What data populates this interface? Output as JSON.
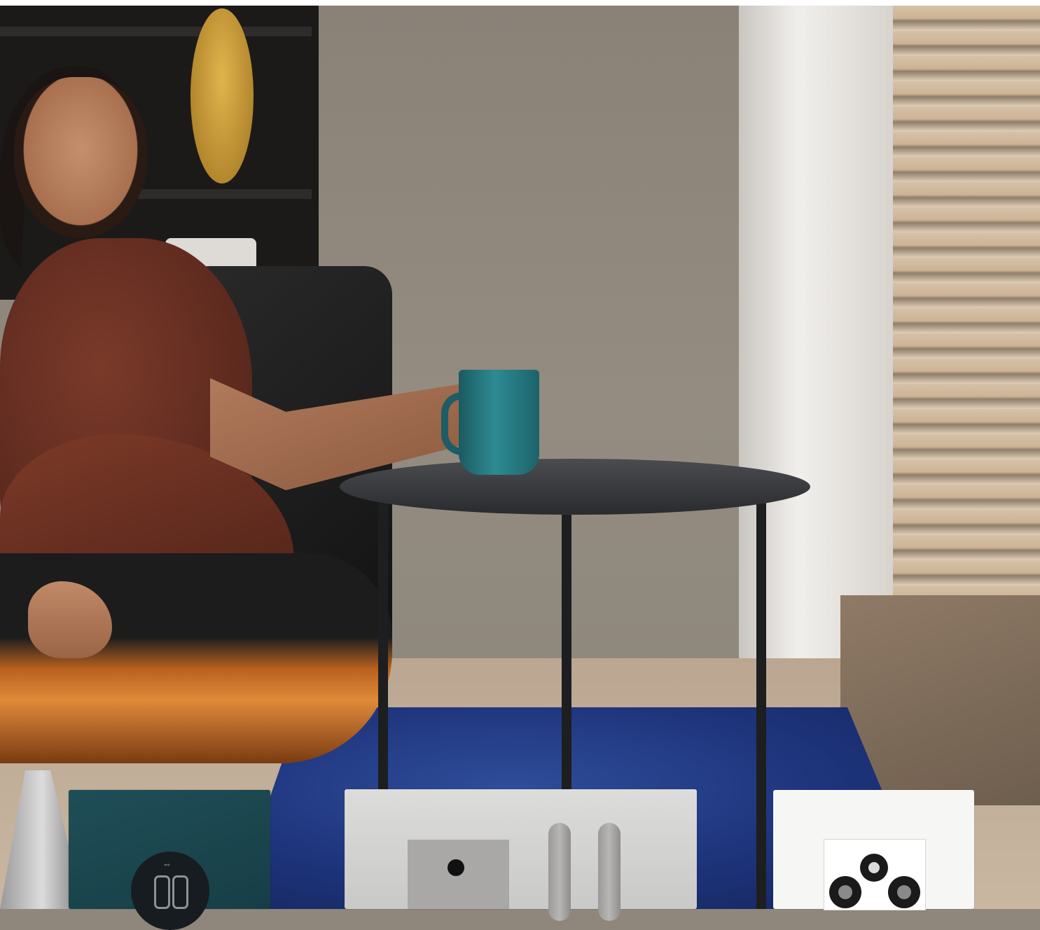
{
  "scene": {
    "description_label": "",
    "colors": {
      "wall": "#8f877c",
      "rug": "#1d337a",
      "mug": "#2e8b92",
      "plate_teal": "#1f4e57",
      "plate_grey": "#d4d4d3",
      "plate_white": "#f6f6f5"
    }
  },
  "icons": {
    "usb_symbol": "⇔"
  }
}
